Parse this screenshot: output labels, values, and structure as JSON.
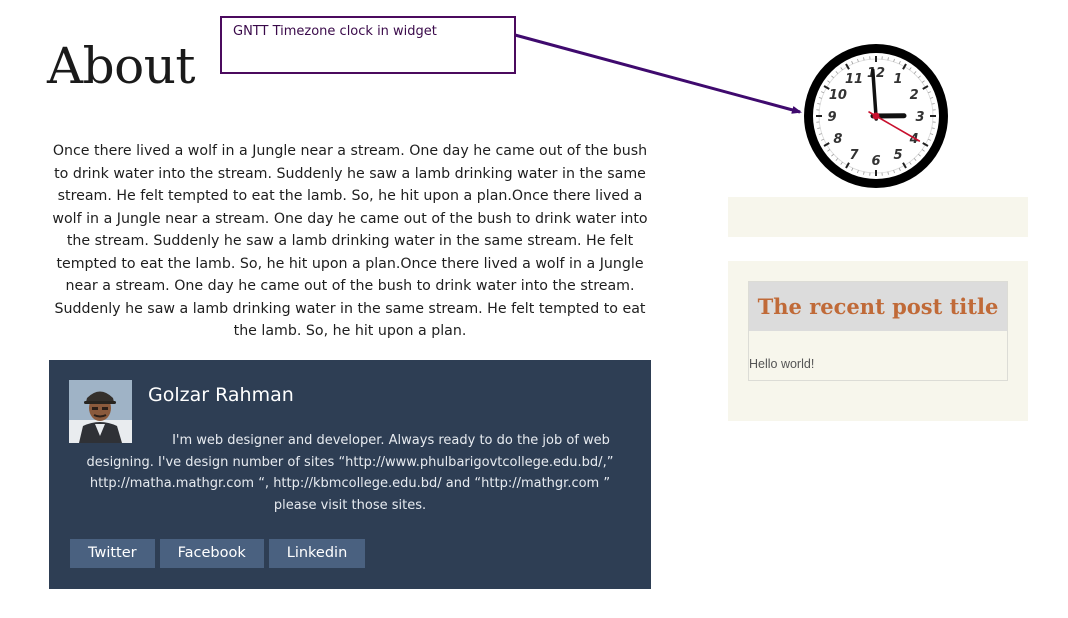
{
  "page": {
    "title": "About",
    "body": "Once there lived a wolf in a Jungle near a stream. One day he came out of the bush to drink water into the stream. Suddenly he saw a lamb drinking water in the same stream. He felt tempted to eat the lamb. So, he hit upon a plan.Once there lived a wolf in a Jungle near a stream. One day he came out of the bush to drink water into the stream. Suddenly he saw a lamb drinking water in the same stream. He felt tempted to eat the lamb. So, he hit upon a plan.Once there lived a wolf in a Jungle near a stream. One day he came out of the bush to drink water into the stream. Suddenly he saw a lamb drinking water in the same stream. He felt tempted to eat the lamb. So, he hit upon a plan."
  },
  "annotation": {
    "text": "GNTT Timezone clock in widget",
    "color": "#4b0a5e"
  },
  "author": {
    "name": "Golzar Rahman",
    "bio": "I'm web designer and developer. Always ready to do the job of web designing. I've design number of sites “http://www.phulbarigovtcollege.edu.bd/,” http://matha.mathgr.com “, http://kbmcollege.edu.bd/ and “http://mathgr.com ” please visit those sites.",
    "links": [
      {
        "label": "Twitter"
      },
      {
        "label": "Facebook"
      },
      {
        "label": "Linkedin"
      }
    ],
    "background_color": "#2e3e54",
    "button_color": "#4a6180"
  },
  "clock": {
    "numerals": [
      "12",
      "1",
      "2",
      "3",
      "4",
      "5",
      "6",
      "7",
      "8",
      "9",
      "10",
      "11"
    ],
    "time": {
      "hour": 2,
      "minute": 59,
      "second": 20
    }
  },
  "sidebar": {
    "recent_posts": {
      "title": "The recent post title",
      "items": [
        {
          "label": "Hello world!"
        }
      ],
      "title_color": "#c06a38"
    }
  }
}
